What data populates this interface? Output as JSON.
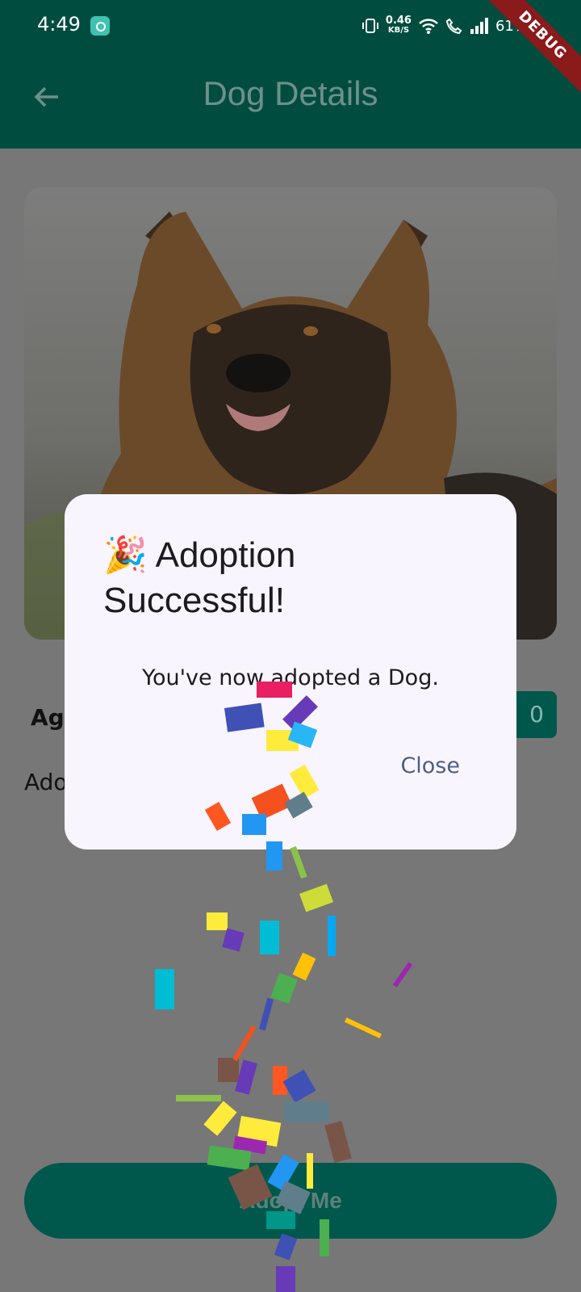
{
  "status_bar": {
    "time": "4:49",
    "speed_value": "0.46",
    "speed_unit": "KB/S",
    "battery": "61%",
    "icons": [
      "vibrate-icon",
      "wifi-icon",
      "call-icon",
      "signal-icon"
    ]
  },
  "debug_banner": "DEBUG",
  "app_bar": {
    "title": "Dog Details"
  },
  "dog": {
    "age_label": "Age",
    "price_tail": "0",
    "adopted_label": "Ado"
  },
  "dialog": {
    "title_emoji": "🎉",
    "title": "Adoption Successful!",
    "message": "You've now adopted a Dog.",
    "close_label": "Close"
  },
  "adopt_button": {
    "label": "Adopt Me"
  },
  "colors": {
    "primary": "#004d40",
    "dialog_bg": "#f9f5ff",
    "close_text": "#4d5e86",
    "scrim": "#777777"
  }
}
